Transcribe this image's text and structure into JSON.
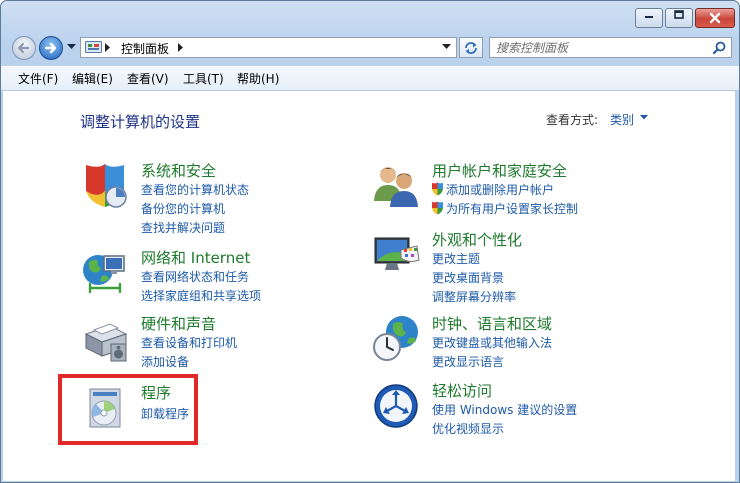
{
  "address": {
    "breadcrumb": "控制面板"
  },
  "search": {
    "placeholder": "搜索控制面板"
  },
  "menu": {
    "items": [
      "文件(F)",
      "编辑(E)",
      "查看(V)",
      "工具(T)",
      "帮助(H)"
    ]
  },
  "content": {
    "title": "调整计算机的设置",
    "view_by_label": "查看方式:",
    "view_by_value": "类别"
  },
  "categories": {
    "system": {
      "title": "系统和安全",
      "links": [
        "查看您的计算机状态",
        "备份您的计算机",
        "查找并解决问题"
      ],
      "icon": "shield-security-icon"
    },
    "network": {
      "title": "网络和 Internet",
      "links": [
        "查看网络状态和任务",
        "选择家庭组和共享选项"
      ],
      "icon": "network-globe-icon"
    },
    "hardware": {
      "title": "硬件和声音",
      "links": [
        "查看设备和打印机",
        "添加设备"
      ],
      "icon": "printer-icon"
    },
    "programs": {
      "title": "程序",
      "links": [
        "卸载程序"
      ],
      "icon": "programs-disc-icon"
    },
    "users": {
      "title": "用户帐户和家庭安全",
      "links": [
        "添加或删除用户帐户",
        "为所有用户设置家长控制"
      ],
      "icon": "users-icon"
    },
    "appearance": {
      "title": "外观和个性化",
      "links": [
        "更改主题",
        "更改桌面背景",
        "调整屏幕分辨率"
      ],
      "icon": "monitor-palette-icon"
    },
    "clock": {
      "title": "时钟、语言和区域",
      "links": [
        "更改键盘或其他输入法",
        "更改显示语言"
      ],
      "icon": "clock-globe-icon"
    },
    "ease": {
      "title": "轻松访问",
      "links": [
        "使用 Windows 建议的设置",
        "优化视频显示"
      ],
      "icon": "ease-of-access-icon"
    }
  },
  "colors": {
    "link": "#1e5aa8",
    "category_title": "#1e7a2c",
    "page_title": "#1e3287",
    "highlight": "#e02a2a"
  }
}
